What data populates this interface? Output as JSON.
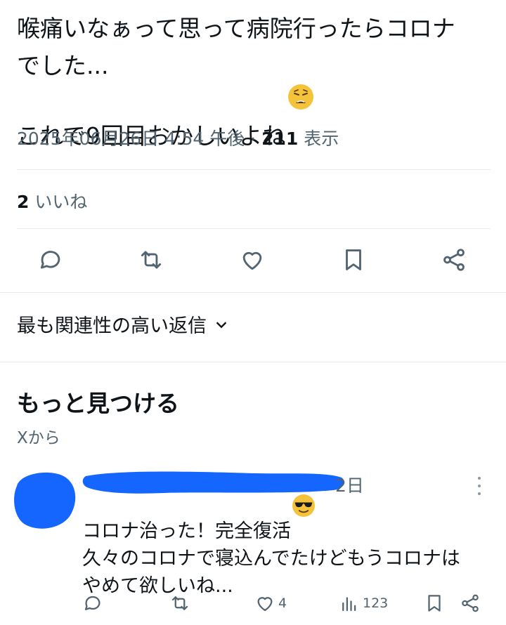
{
  "tweet": {
    "text_line1": "喉痛いなぁって思って病院行ったらコロナ",
    "text_line2": "でした...",
    "text_line3": "これで9回目おかしいよね",
    "emoji": "😩",
    "timestamp": "2025年06月26日 4:54 午後",
    "separator": "·",
    "view_count": "211",
    "view_label": "表示"
  },
  "stats": {
    "like_count": "2",
    "like_label": "いいね"
  },
  "actions": [
    "reply-icon",
    "retweet-icon",
    "like-icon",
    "bookmark-icon",
    "share-icon"
  ],
  "replies_sort": {
    "label": "最も関連性の高い返信"
  },
  "discover": {
    "heading": "もっと見つける",
    "source": "Xから"
  },
  "reply": {
    "time": "2日",
    "line1": "コロナ治った！完全復活",
    "line1_emoji": "😎",
    "line2": "久々のコロナで寝込んでたけどもうコロナは",
    "line3": "やめて欲しいね...",
    "likes": "4",
    "views": "123"
  },
  "colors": {
    "text": "#0f1419",
    "muted": "#536471",
    "divider": "#e6ecf0",
    "redaction": "#1565ff"
  }
}
